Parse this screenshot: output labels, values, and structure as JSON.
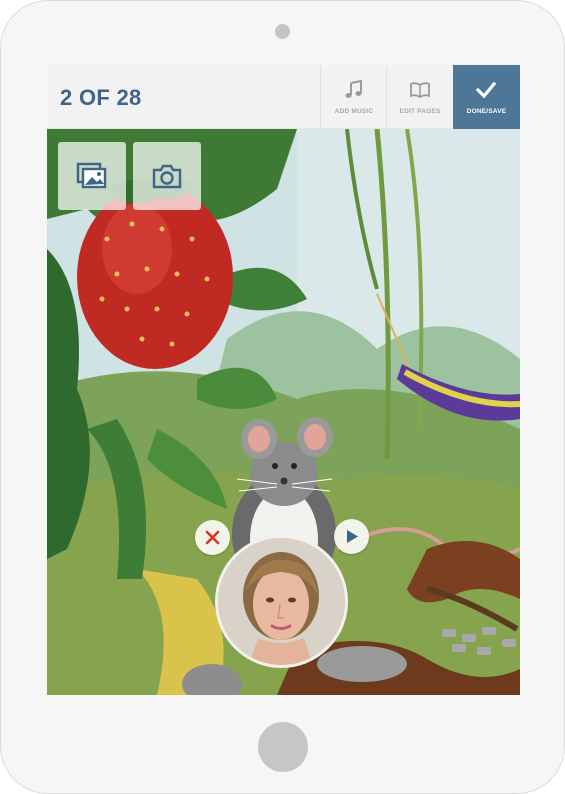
{
  "header": {
    "page_counter": "2 OF 28",
    "tools": [
      {
        "label": "ADD MUSIC",
        "icon": "music-note-icon"
      },
      {
        "label": "EDIT PAGES",
        "icon": "open-book-icon"
      },
      {
        "label": "DONE/SAVE",
        "icon": "checkmark-icon"
      }
    ]
  },
  "page_media": {
    "gallery_icon": "photo-gallery-icon",
    "camera_icon": "camera-icon"
  },
  "narration": {
    "delete_icon": "close-x-icon",
    "play_icon": "play-icon"
  },
  "colors": {
    "accent": "#4e7697",
    "counter_text": "#3f6487",
    "delete_red": "#d9332b",
    "play_blue": "#3f6487"
  }
}
